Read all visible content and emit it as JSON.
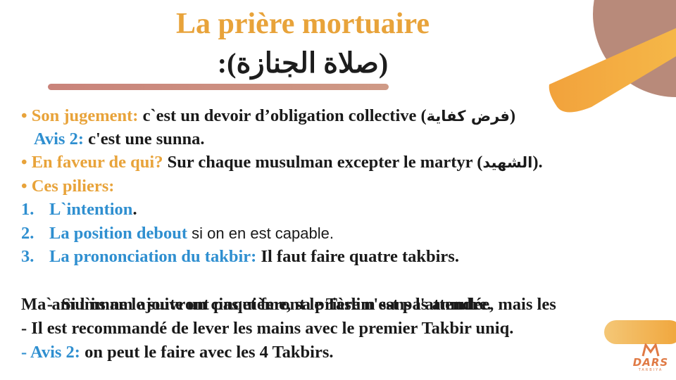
{
  "title": {
    "main": "La prière mortuaire",
    "arabic": "(صلاة الجنازة):"
  },
  "content": {
    "line1": {
      "bullet": "•",
      "label": "Son jugement:",
      "text": " c`est un devoir d’obligation collective (",
      "arabic": "فرض كفاية",
      "close": ")"
    },
    "line2": {
      "label": "Avis 2:",
      "text": " c'est une sunna."
    },
    "line3": {
      "bullet": "•",
      "label": "En faveur de qui?",
      "text": "  Sur chaque musulman excepter le martyr (",
      "arabic": "الشهيد",
      "close": ")."
    },
    "line4": {
      "bullet": "•",
      "label": "Ces piliers:"
    },
    "line5": {
      "num": "1.",
      "label": "L`intention",
      "text": "."
    },
    "line6": {
      "num": "2.",
      "label": "La position debout",
      "text": " si on en est capable."
    },
    "line7": {
      "num": "3.",
      "label": "La prononciation du takbir:",
      "text": " Il faut faire quatre takbirs."
    },
    "line8": {
      "text": "  -  Si l`imam ajoute un cinquième, sa prière n'est pas annulée, mais les"
    },
    "line9": {
      "text": "Ma`amums ne le suivront pas et feront le Taslim sans l'attendre."
    },
    "line10": {
      "text": "-  Il est recommandé de lever les mains avec le premier Takbir uniq."
    },
    "line11": {
      "dash": "-",
      "label": " Avis 2:",
      "text": " on peut le faire avec les 4 Takbirs."
    }
  },
  "logo": {
    "word": "DARS",
    "sub": "TARBIYA"
  },
  "colors": {
    "orange": "#e8a33a",
    "blue": "#2f8fd0",
    "rose": "#b88a7a"
  }
}
